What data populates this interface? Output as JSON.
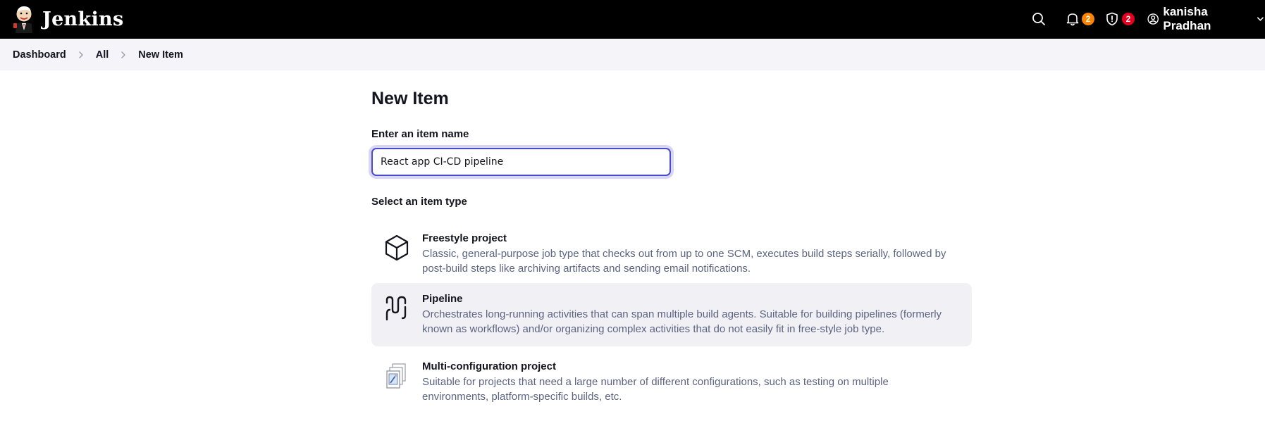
{
  "header": {
    "brand": "Jenkins",
    "notifications_count": "2",
    "security_count": "2",
    "user_name": "kanisha Pradhan",
    "icons": [
      "jenkins-logo",
      "search-icon",
      "bell-icon",
      "shield-icon",
      "user-icon",
      "chevron-down-icon"
    ],
    "colors": {
      "bar": "#000000",
      "badge_notifications": "#fe8300",
      "badge_security": "#e6001f"
    }
  },
  "breadcrumb": {
    "items": [
      "Dashboard",
      "All",
      "New Item"
    ]
  },
  "main": {
    "title": "New Item",
    "name_label": "Enter an item name",
    "name_value": "React app CI-CD pipeline",
    "type_label": "Select an item type",
    "item_types": [
      {
        "title": "Freestyle project",
        "description": "Classic, general-purpose job type that checks out from up to one SCM, executes build steps serially, followed by post-build steps like archiving artifacts and sending email notifications.",
        "icon": "cube-icon",
        "selected": false
      },
      {
        "title": "Pipeline",
        "description": "Orchestrates long-running activities that can span multiple build agents. Suitable for building pipelines (formerly known as workflows) and/or organizing complex activities that do not easily fit in free-style job type.",
        "icon": "pipeline-icon",
        "selected": true
      },
      {
        "title": "Multi-configuration project",
        "description": "Suitable for projects that need a large number of different configurations, such as testing on multiple environments, platform-specific builds, etc.",
        "icon": "multi-config-icon",
        "selected": false
      }
    ],
    "colors": {
      "input_border": "#4b4bcf",
      "selected_bg": "#f1f0f5",
      "description_text": "#5b6480"
    }
  }
}
